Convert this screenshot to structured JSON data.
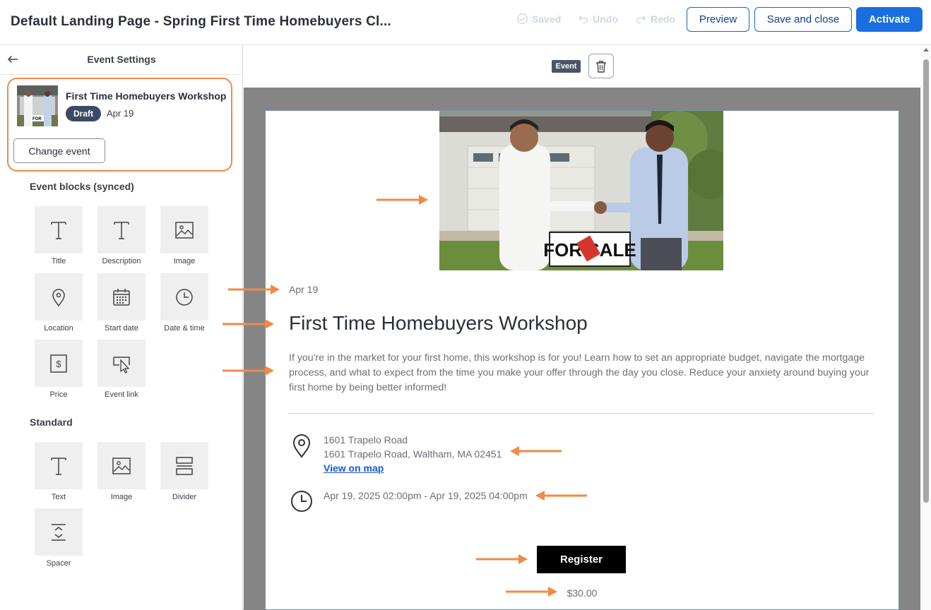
{
  "header": {
    "title": "Default Landing Page - Spring First Time Homebuyers Cl...",
    "saved_label": "Saved",
    "undo_label": "Undo",
    "redo_label": "Redo",
    "preview_label": "Preview",
    "save_close_label": "Save and close",
    "activate_label": "Activate"
  },
  "sidebar": {
    "title": "Event Settings",
    "event": {
      "name": "First Time Homebuyers Workshop",
      "status": "Draft",
      "date": "Apr 19",
      "change_label": "Change event"
    },
    "event_blocks_label": "Event blocks (synced)",
    "event_blocks": [
      {
        "label": "Title",
        "icon": "title-icon"
      },
      {
        "label": "Description",
        "icon": "description-icon"
      },
      {
        "label": "Image",
        "icon": "image-icon"
      },
      {
        "label": "Location",
        "icon": "location-pin-icon"
      },
      {
        "label": "Start date",
        "icon": "calendar-icon"
      },
      {
        "label": "Date & time",
        "icon": "clock-icon"
      },
      {
        "label": "Price",
        "icon": "dollar-icon"
      },
      {
        "label": "Event link",
        "icon": "cursor-link-icon"
      }
    ],
    "standard_label": "Standard",
    "standard_blocks": [
      {
        "label": "Text",
        "icon": "text-icon"
      },
      {
        "label": "Image",
        "icon": "image-icon"
      },
      {
        "label": "Divider",
        "icon": "divider-icon"
      },
      {
        "label": "Spacer",
        "icon": "spacer-icon"
      }
    ]
  },
  "canvas": {
    "tag_label": "Event",
    "event": {
      "date": "Apr 19",
      "title": "First Time Homebuyers Workshop",
      "description": "If you're in the market for your first home, this workshop is for you! Learn how to set an appropriate budget, navigate the mortgage process, and what to expect from the time you make your offer through the day you close. Reduce your anxiety around buying your first home by being better informed!",
      "location_name": "1601 Trapelo Road",
      "location_address": "1601 Trapelo Road, Waltham, MA 02451",
      "map_link": "View on map",
      "datetime": "Apr 19, 2025 02:00pm - Apr 19, 2025 04:00pm",
      "register_label": "Register",
      "price": "$30.00"
    }
  },
  "colors": {
    "accent_blue": "#1a6fe0",
    "annotation_orange": "#f08a45",
    "draft_badge": "#3c4a66"
  }
}
